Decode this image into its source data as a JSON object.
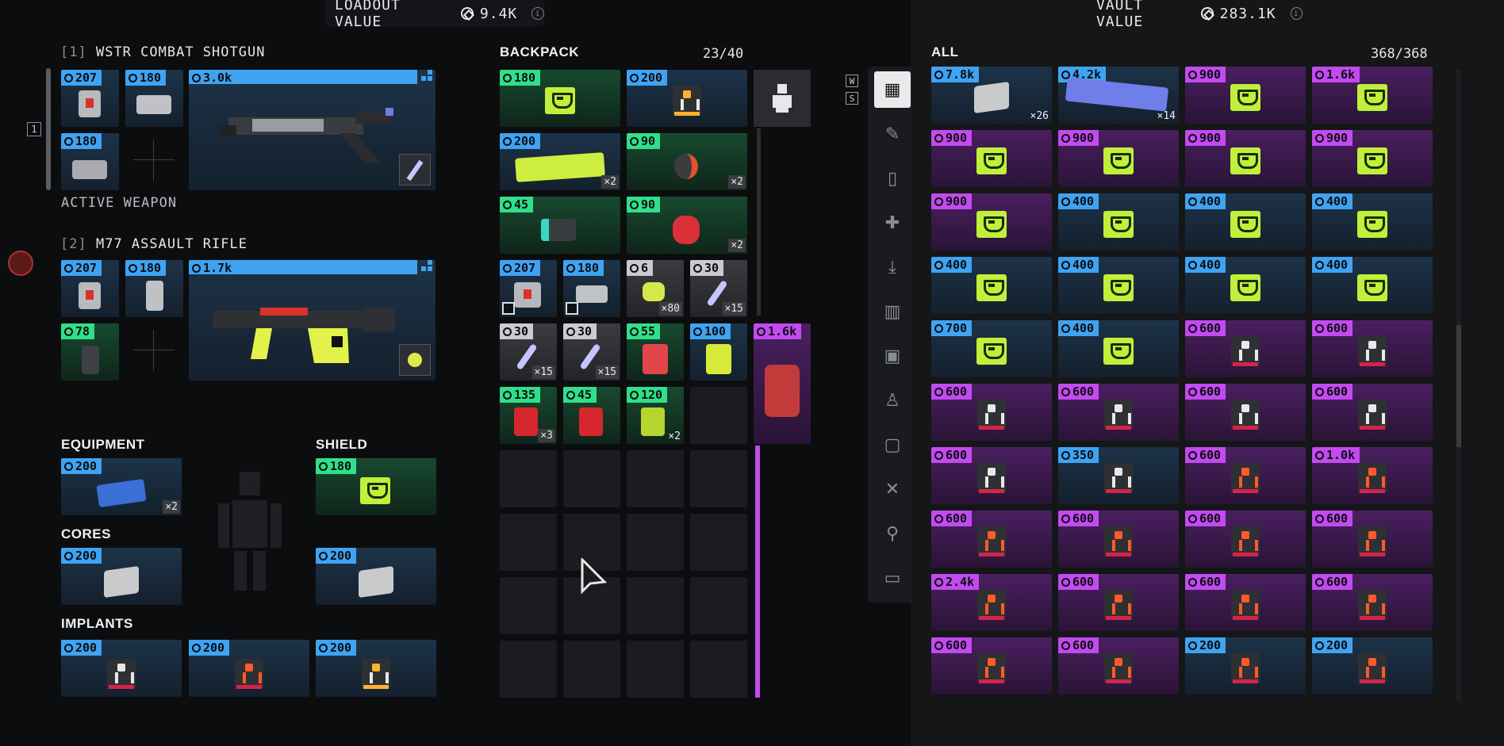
{
  "header": {
    "loadout_label": "LOADOUT VALUE",
    "loadout_value": "9.4K",
    "vault_label": "VAULT VALUE",
    "vault_value": "283.1K",
    "info_glyph": "i"
  },
  "keys": {
    "w": "W",
    "s": "S",
    "slot_indicator": "1"
  },
  "weapons": [
    {
      "index": "[1]",
      "name": "WSTR COMBAT SHOTGUN",
      "mods": [
        "207",
        "180",
        "180"
      ],
      "value": "3.0k",
      "status": "ACTIVE WEAPON"
    },
    {
      "index": "[2]",
      "name": "M77 ASSAULT RIFLE",
      "mods": [
        "207",
        "180",
        "78"
      ],
      "value": "1.7k"
    }
  ],
  "equipment": {
    "equipment_label": "EQUIPMENT",
    "equipment_item": {
      "value": "200",
      "qty": "×2"
    },
    "shield_label": "SHIELD",
    "shield_item": {
      "value": "180"
    },
    "cores_label": "CORES",
    "cores": [
      "200",
      "200"
    ],
    "implants_label": "IMPLANTS",
    "implants": [
      "200",
      "200",
      "200"
    ]
  },
  "backpack": {
    "title": "BACKPACK",
    "count": "23/40",
    "row1": [
      {
        "value": "180",
        "color": "green"
      },
      {
        "value": "200",
        "color": "blue"
      }
    ],
    "row2": [
      {
        "value": "200",
        "color": "blue",
        "qty": "×2"
      },
      {
        "value": "90",
        "color": "green",
        "qty": "×2"
      }
    ],
    "row3": [
      {
        "value": "45",
        "color": "green"
      },
      {
        "value": "90",
        "color": "green",
        "qty": "×2"
      }
    ],
    "row4": [
      {
        "value": "207",
        "color": "blue"
      },
      {
        "value": "180",
        "color": "blue"
      },
      {
        "value": "6",
        "color": "gray",
        "qty": "×80"
      },
      {
        "value": "30",
        "color": "gray",
        "qty": "×15"
      }
    ],
    "row5": [
      {
        "value": "30",
        "color": "gray",
        "qty": "×15"
      },
      {
        "value": "30",
        "color": "gray",
        "qty": "×15"
      },
      {
        "value": "55",
        "color": "green"
      },
      {
        "value": "100",
        "color": "blue"
      }
    ],
    "row6": [
      {
        "value": "135",
        "color": "green",
        "qty": "×3"
      },
      {
        "value": "45",
        "color": "green"
      },
      {
        "value": "120",
        "color": "green",
        "qty": "×2"
      }
    ],
    "side_item": {
      "value": "1.6k"
    }
  },
  "vault": {
    "title": "ALL",
    "count": "368/368",
    "rows": [
      [
        {
          "v": "7.8k",
          "c": "blue",
          "q": "×26"
        },
        {
          "v": "4.2k",
          "c": "blue",
          "q": "×14"
        },
        {
          "v": "900",
          "c": "purple"
        },
        {
          "v": "1.6k",
          "c": "purple"
        }
      ],
      [
        {
          "v": "900",
          "c": "purple"
        },
        {
          "v": "900",
          "c": "purple"
        },
        {
          "v": "900",
          "c": "purple"
        },
        {
          "v": "900",
          "c": "purple"
        }
      ],
      [
        {
          "v": "900",
          "c": "purple"
        },
        {
          "v": "400",
          "c": "blue"
        },
        {
          "v": "400",
          "c": "blue"
        },
        {
          "v": "400",
          "c": "blue"
        }
      ],
      [
        {
          "v": "400",
          "c": "blue"
        },
        {
          "v": "400",
          "c": "blue"
        },
        {
          "v": "400",
          "c": "blue"
        },
        {
          "v": "400",
          "c": "blue"
        }
      ],
      [
        {
          "v": "700",
          "c": "blue"
        },
        {
          "v": "400",
          "c": "blue"
        },
        {
          "v": "600",
          "c": "purple"
        },
        {
          "v": "600",
          "c": "purple"
        }
      ],
      [
        {
          "v": "600",
          "c": "purple"
        },
        {
          "v": "600",
          "c": "purple"
        },
        {
          "v": "600",
          "c": "purple"
        },
        {
          "v": "600",
          "c": "purple"
        }
      ],
      [
        {
          "v": "600",
          "c": "purple"
        },
        {
          "v": "350",
          "c": "blue"
        },
        {
          "v": "600",
          "c": "purple"
        },
        {
          "v": "1.0k",
          "c": "purple"
        }
      ],
      [
        {
          "v": "600",
          "c": "purple"
        },
        {
          "v": "600",
          "c": "purple"
        },
        {
          "v": "600",
          "c": "purple"
        },
        {
          "v": "600",
          "c": "purple"
        }
      ],
      [
        {
          "v": "2.4k",
          "c": "purple"
        },
        {
          "v": "600",
          "c": "purple"
        },
        {
          "v": "600",
          "c": "purple"
        },
        {
          "v": "600",
          "c": "purple"
        }
      ],
      [
        {
          "v": "600",
          "c": "purple"
        },
        {
          "v": "600",
          "c": "purple"
        },
        {
          "v": "200",
          "c": "blue"
        },
        {
          "v": "200",
          "c": "blue"
        }
      ]
    ]
  },
  "side_tabs": [
    "grid-icon",
    "pencil-icon",
    "cup-icon",
    "medkit-icon",
    "inbox-icon",
    "ammo-icon",
    "chip-icon",
    "figure-icon",
    "frame-icon",
    "close-box-icon",
    "key-icon",
    "panel-icon"
  ],
  "colors": {
    "blue": "#3fa3f2",
    "green": "#2fe08a",
    "purple": "#c24af0",
    "lime": "#bff03a"
  }
}
